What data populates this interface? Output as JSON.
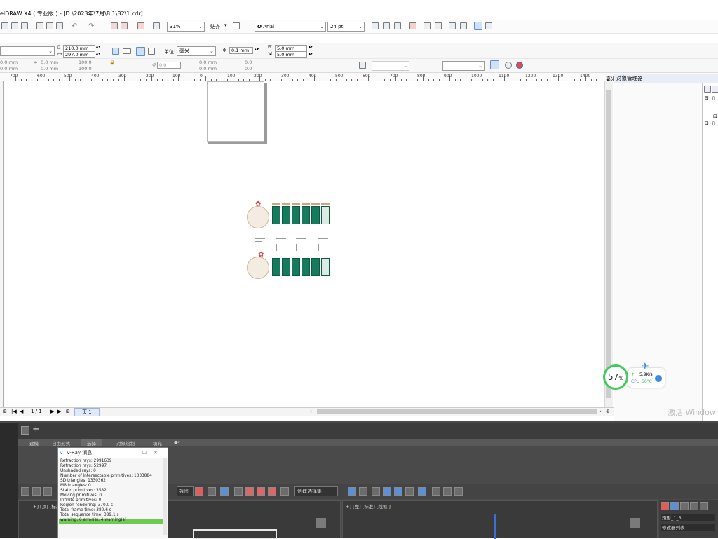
{
  "window": {
    "title": "elDRAW X4 ( 专业版 ) - [D:\\2023年\\7月\\8.1\\82\\1.cdr]"
  },
  "toolbar_standard": {
    "zoom_value": "31%",
    "paste_label": "贴齐",
    "font_name": "Arial",
    "font_size": "24 pt"
  },
  "property_bar": {
    "width_value": "210.0 mm",
    "height_value": "297.0 mm",
    "units_label": "单位:",
    "units_value": "毫米",
    "nudge_value": "0.1 mm",
    "dup_x": "5.0 mm",
    "dup_y": "5.0 mm"
  },
  "transform_bar": {
    "x1": "0.0 mm",
    "x2": "0.0 mm",
    "w_pct": "100.0",
    "h_pct": "100.0",
    "angle": "0.0",
    "pos1": "0.0 mm",
    "pos2": "0.0 mm",
    "val1": "0.0",
    "val2": "0.0"
  },
  "ruler": {
    "labels": [
      "700",
      "600",
      "500",
      "400",
      "300",
      "200",
      "100",
      "0",
      "100",
      "200",
      "300",
      "400",
      "500",
      "600",
      "700",
      "800",
      "900",
      "1000",
      "1100",
      "1200",
      "1300",
      "1400"
    ],
    "unit_label": "毫米"
  },
  "object_manager": {
    "title": "对象管理器"
  },
  "page_nav": {
    "page_counter": "1 / 1",
    "page_tab": "页 1"
  },
  "system_widget": {
    "cpu_percent": "57",
    "percent_sign": "%",
    "net_speed": "5.9K/s",
    "cpu_label": "CPU",
    "cpu_temp": "56°C"
  },
  "watermark": {
    "activate_text": "激活 Window"
  },
  "max_app": {
    "tabs": [
      "建模",
      "自由形式",
      "选择",
      "对象绘制",
      "填充"
    ],
    "viewport_left_label": "+] [顶] [标准] [线框 ]",
    "viewport_right_label": "+] [左] [标准] [线框 ]",
    "right_panel_name": "矩形_1_5",
    "right_panel_list": "修改器列表",
    "select_dropdown": "创建选择集",
    "view_dropdown": "视图"
  },
  "vray_log": {
    "title": "V-Ray 消息",
    "lines": [
      "Refraction rays: 2991639",
      "Refraction rays: 52997",
      "Unshaded rays: 0",
      "Number of intersectable primitives: 1333884",
      "SD triangles: 1330362",
      "MB triangles: 0",
      "Static primitives: 3582",
      "Moving primitives: 0",
      "Infinite primitives: 0",
      "Region rendering: 370.0 s",
      "Total frame time: 380.6 s",
      "Total sequence time: 389.1 s",
      "warning: 0 error(s), 4 warning(s)"
    ]
  }
}
